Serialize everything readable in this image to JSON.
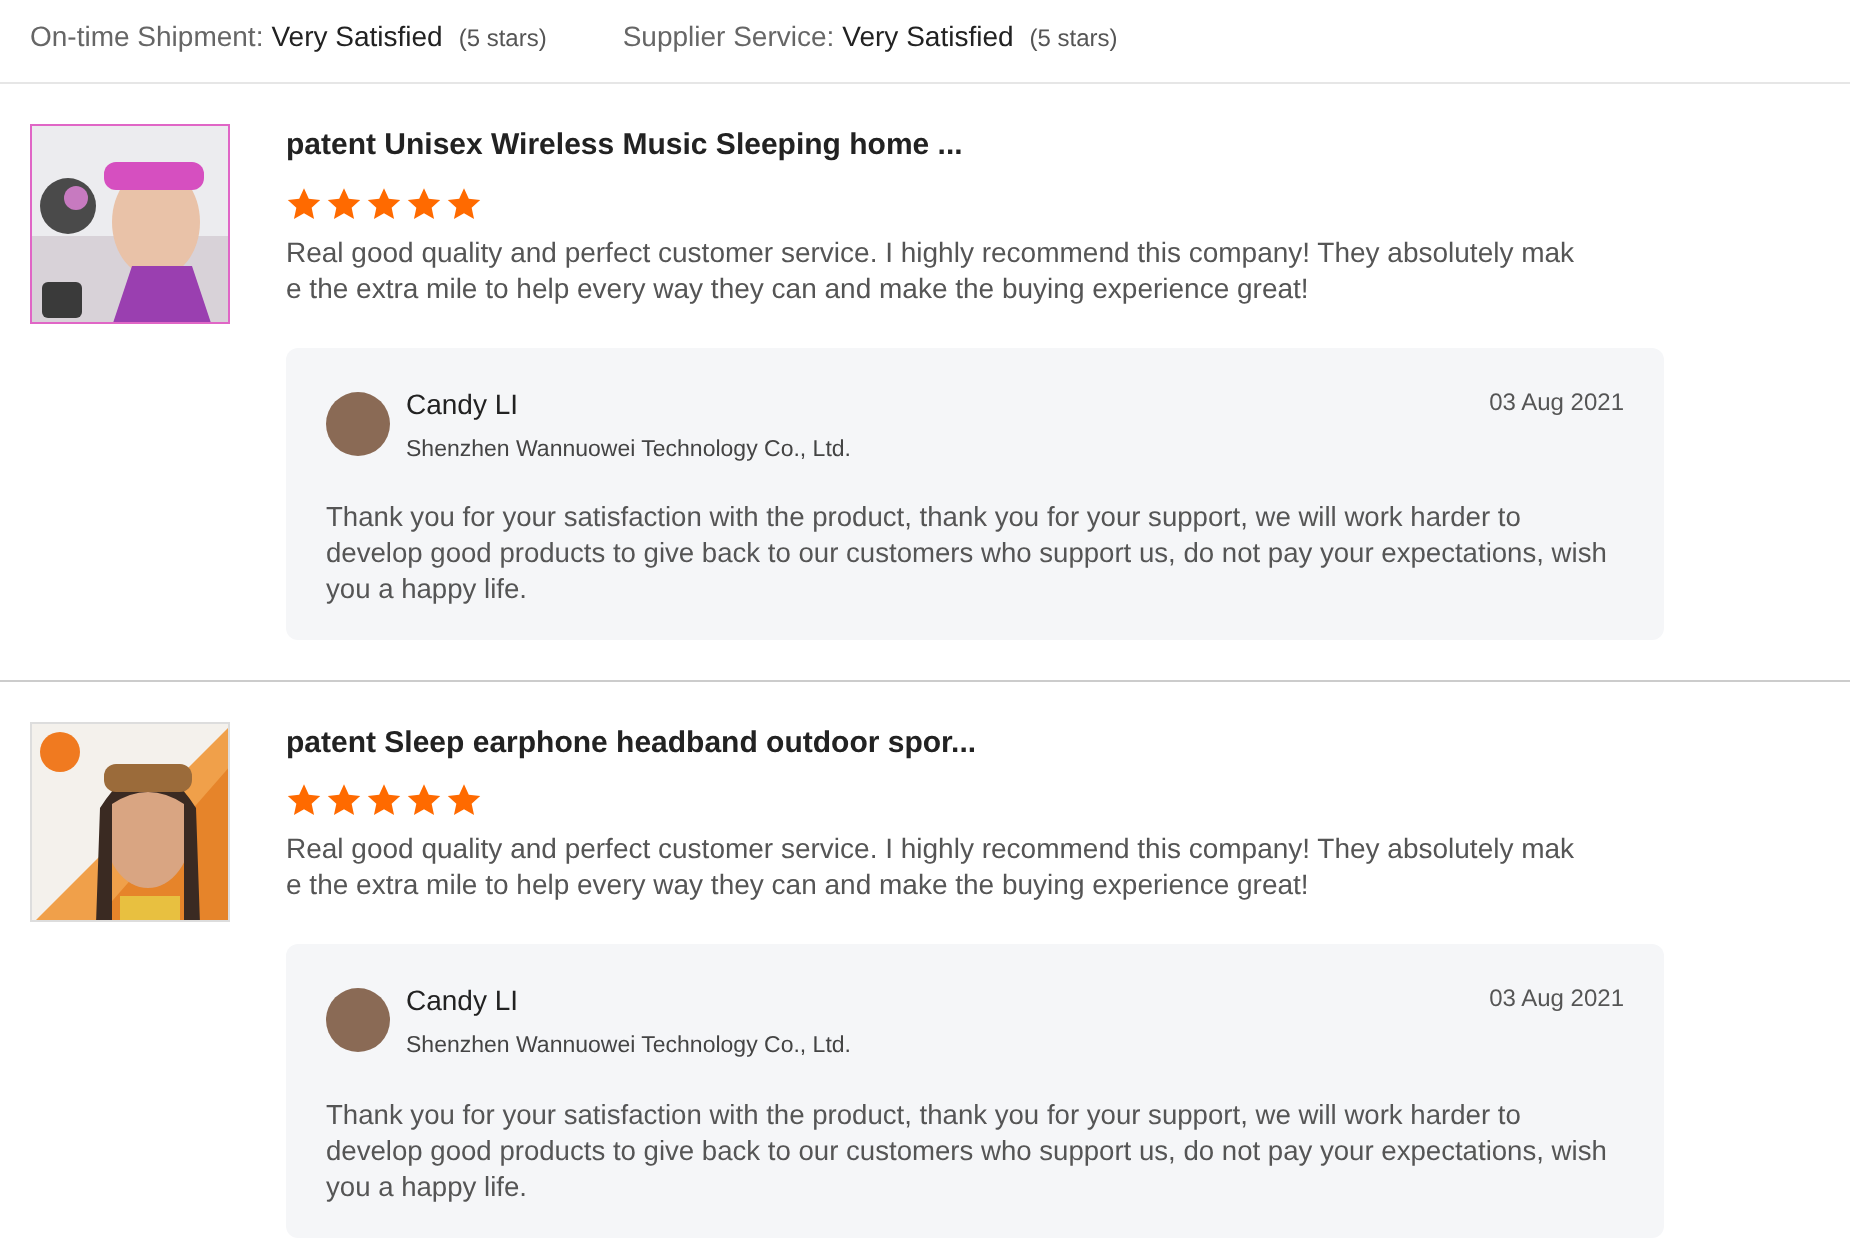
{
  "ratings": [
    {
      "label": "On-time Shipment:",
      "value": "Very Satisfied",
      "note": "(5 stars)"
    },
    {
      "label": "Supplier Service:",
      "value": "Very Satisfied",
      "note": "(5 stars)"
    }
  ],
  "reviews": [
    {
      "product": "patent Unisex Wireless Music Sleeping home ...",
      "stars": 5,
      "text": "Real good quality and perfect customer service. I highly recommend this company! They absolutely make the extra mile to help every way they can and make the buying experience great!",
      "reply": {
        "name": "Candy LI",
        "company": "Shenzhen Wannuowei Technology Co., Ltd.",
        "date": "03 Aug 2021",
        "text": "Thank you for your satisfaction with the product, thank you for your support, we will work harder to develop good products to give back to our customers who support us, do not pay your expectations, wish you a happy life."
      }
    },
    {
      "product": "patent Sleep earphone headband outdoor spor...",
      "stars": 5,
      "text": "Real good quality and perfect customer service. I highly recommend this company! They absolutely make the extra mile to help every way they can and make the buying experience great!",
      "reply": {
        "name": "Candy LI",
        "company": "Shenzhen Wannuowei Technology Co., Ltd.",
        "date": "03 Aug 2021",
        "text": "Thank you for your satisfaction with the product, thank you for your support, we will work harder to develop good products to give back to our customers who support us, do not pay your expectations, wish you a happy life."
      }
    }
  ]
}
